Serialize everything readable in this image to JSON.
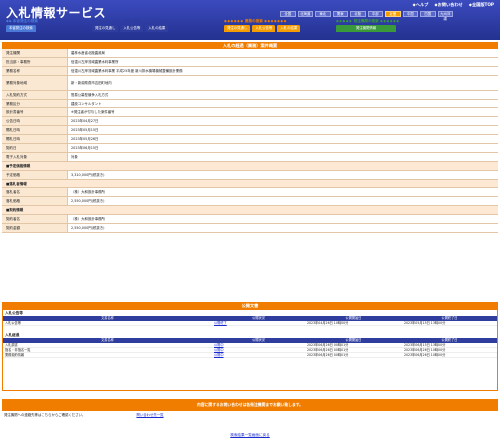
{
  "header": {
    "title": "入札情報サービス",
    "links": [
      "ヘルプ",
      "お問い合わせ",
      "全国版TOP"
    ],
    "regions": [
      "全国",
      "北海道",
      "東北",
      "関東",
      "北陸",
      "中部",
      "近畿",
      "中国",
      "四国",
      "九州沖縄"
    ],
    "active_region": "近畿"
  },
  "nav": {
    "groups": [
      {
        "label": "本省発注の検索",
        "color": "#4a79d8",
        "buttons": [
          "本省発注の検索"
        ]
      },
      {
        "label": "工事の検索",
        "color": "#2f3d9f",
        "buttons": [
          "発注の見通し",
          "入札公告等",
          "入札の結果"
        ]
      },
      {
        "label": "業務の検索",
        "color": "#f59d00",
        "buttons": [
          "発注の見通し",
          "入札公告等",
          "入札の結果"
        ]
      },
      {
        "label": "発注機関の検索",
        "color": "#3a9a3a",
        "buttons": [
          "発注機関情報"
        ]
      }
    ]
  },
  "detail": {
    "title": "入札の経過（業務）案件概要",
    "rows": [
      {
        "label": "発注機関",
        "value": "農林水産省北陸農政局"
      },
      {
        "label": "担当部・事務所",
        "value": "信濃川左岸流域農業水利事業所"
      },
      {
        "label": "業務名称",
        "value": "信濃川左岸流域農業水利事業 平成25年度 新川排水機場機械整備設計業務"
      },
      {
        "label": "業務対象地域",
        "value": "新・新潟県燕市吉田町地内",
        "extra": "新",
        "tall": true
      },
      {
        "label": "入札契約方式",
        "value": "簡易公募型競争入札方式"
      },
      {
        "label": "業務区分",
        "value": "建設コンサルタント"
      },
      {
        "label": "設計書番号",
        "value": "※発注者が付与した案件番号"
      },
      {
        "label": "公告日時",
        "value": "2023年04月27日"
      },
      {
        "label": "開札日時",
        "value": "2023年05月15日"
      },
      {
        "label": "開札日時",
        "value": "2023年05月26日"
      },
      {
        "label": "契約日",
        "value": "2023年06月15日"
      },
      {
        "label": "電子入札対象",
        "value": "対象"
      },
      {
        "label": "■予定価格情報",
        "value": "",
        "sub": true
      },
      {
        "label": "予定価格",
        "value": "3,310,000円(税抜き)"
      },
      {
        "label": "■落札者情報",
        "value": "",
        "sub": true
      },
      {
        "label": "落札者名",
        "value": "（株）大和設計事務所"
      },
      {
        "label": "落札価格",
        "value": "2,550,000円(税抜き)"
      },
      {
        "label": "■契約情報",
        "value": "",
        "sub": true
      },
      {
        "label": "契約者名",
        "value": "（株）大和設計事務所"
      },
      {
        "label": "契約金額",
        "value": "2,550,000円(税抜き)"
      }
    ]
  },
  "documents": {
    "title": "公開文書",
    "sections": [
      {
        "title": "入札公告等",
        "headers": [
          "文書名称",
          "公開状況",
          "公開開始日",
          "公開終了日"
        ],
        "rows": [
          {
            "name": "入札公告等",
            "status": "公開終了",
            "start": "2023年04月26日 10時00分",
            "end": "2023年05月15日 13時00分"
          }
        ]
      },
      {
        "title": "入札経過",
        "headers": [
          "文書名称",
          "公開状況",
          "公開開始日",
          "公開終了日"
        ],
        "rows": [
          {
            "name": "入札調書",
            "status": "公開中",
            "start": "2023年06月26日 00時01分",
            "end": "2023年06月15日 13時00分"
          },
          {
            "name": "指名・非指名一覧",
            "status": "公開中",
            "start": "2023年06月26日 00時01分",
            "end": "2023年06月26日 10時00分"
          },
          {
            "name": "業務契約情報",
            "status": "公開中",
            "start": "2023年06月26日 00時01分",
            "end": "2023年06月26日 10時00分"
          }
        ]
      }
    ]
  },
  "inquiry": {
    "title": "内容に関するお問い合わせは各発注機関までお願い致します。",
    "text": "発注機関への連絡先等はこちらからご確認ください。",
    "link": "問い合わせ先一覧"
  },
  "back_link": "検索結果一覧画面に戻る"
}
